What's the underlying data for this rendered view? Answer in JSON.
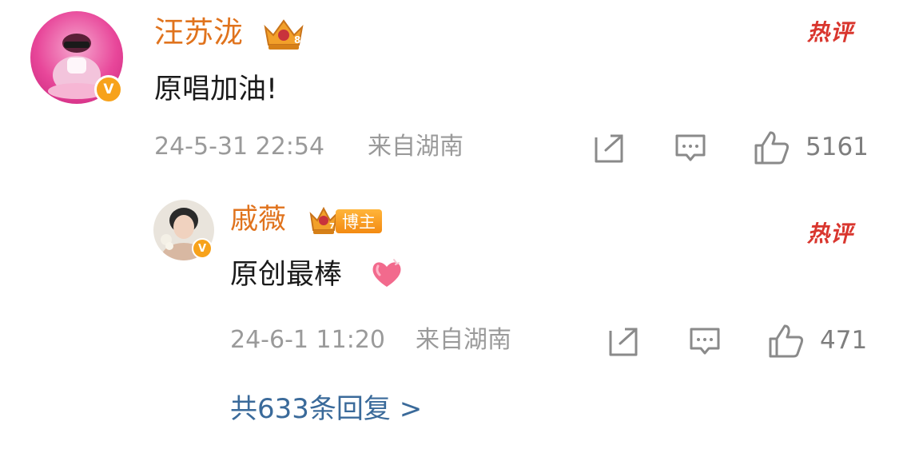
{
  "comment": {
    "username": "汪苏泷",
    "text": "原唱加油!",
    "timestamp": "24-5-31 22:54",
    "location": "来自湖南",
    "likes": "5161",
    "hot_label": "热评",
    "verified_mark": "V",
    "avatar_color": "#e8479a"
  },
  "reply": {
    "username": "戚薇",
    "badge": "博主",
    "text": "原创最棒",
    "timestamp": "24-6-1 11:20",
    "location": "来自湖南",
    "likes": "471",
    "hot_label": "热评",
    "verified_mark": "V",
    "emoji_icon": "heart-love-emoji"
  },
  "more_replies": "共633条回复 >",
  "colors": {
    "username": "#e0731d",
    "hot": "#d9362e",
    "meta": "#9a9a9a",
    "link": "#3a6a9a",
    "verified": "#f7a21b"
  }
}
